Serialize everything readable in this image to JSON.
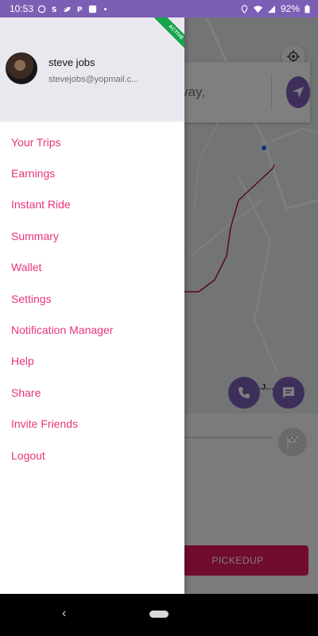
{
  "status_bar": {
    "time": "10:53",
    "battery": "92%",
    "icons_left": [
      "whatsapp-icon",
      "skype-icon",
      "twitter-icon",
      "paypal-icon",
      "app-icon",
      "dot-icon"
    ],
    "icons_right": [
      "location-icon",
      "wifi-icon",
      "signal-icon",
      "battery-icon"
    ]
  },
  "map": {
    "search_text": "vay,",
    "location_label": "RA.J... N"
  },
  "bottom_panel": {
    "pickup_label": "PICKEDUP"
  },
  "drawer": {
    "user_name": "steve jobs",
    "user_email": "stevejobs@yopmail.c...",
    "ribbon": "ACTIVE",
    "menu_items": [
      {
        "label": "Your Trips"
      },
      {
        "label": "Earnings"
      },
      {
        "label": "Instant Ride"
      },
      {
        "label": "Summary"
      },
      {
        "label": "Wallet"
      },
      {
        "label": "Settings"
      },
      {
        "label": "Notification Manager"
      },
      {
        "label": "Help"
      },
      {
        "label": "Share"
      },
      {
        "label": "Invite Friends"
      },
      {
        "label": "Logout"
      }
    ]
  },
  "colors": {
    "status_bar": "#7b5fb5",
    "accent_purple": "#7b5fb5",
    "menu_text": "#e8347c",
    "drawer_header": "#eae8ef",
    "ribbon": "#14a44d",
    "pickup_button": "#e2185b",
    "route": "#b3123a"
  }
}
